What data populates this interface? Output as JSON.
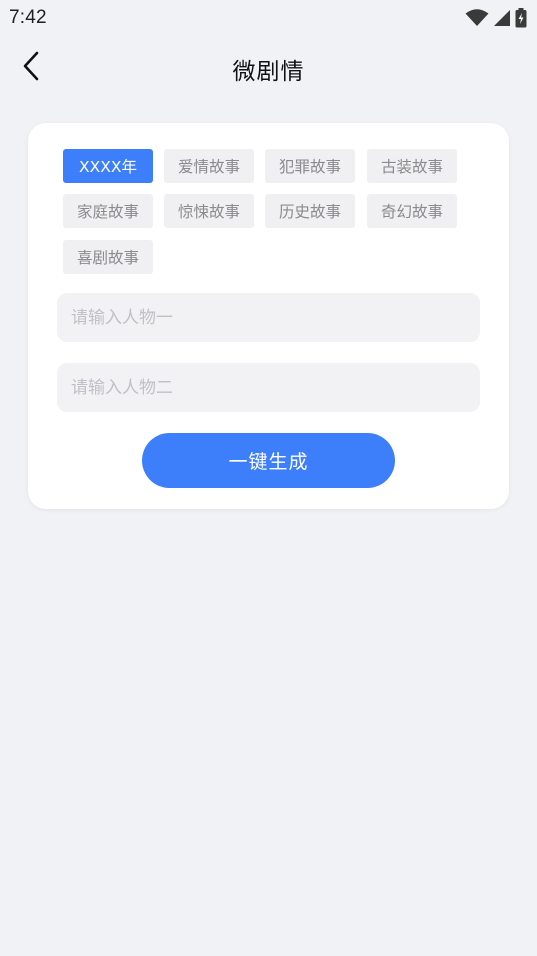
{
  "status_bar": {
    "time": "7:42",
    "icons": [
      "wifi-icon",
      "cellular-signal-icon",
      "battery-charging-icon"
    ]
  },
  "header": {
    "title": "微剧情",
    "back_icon": "chevron-left-icon"
  },
  "tags": [
    {
      "label": "XXXX年",
      "selected": true
    },
    {
      "label": "爱情故事",
      "selected": false
    },
    {
      "label": "犯罪故事",
      "selected": false
    },
    {
      "label": "古装故事",
      "selected": false
    },
    {
      "label": "家庭故事",
      "selected": false
    },
    {
      "label": "惊悚故事",
      "selected": false
    },
    {
      "label": "历史故事",
      "selected": false
    },
    {
      "label": "奇幻故事",
      "selected": false
    },
    {
      "label": "喜剧故事",
      "selected": false
    }
  ],
  "inputs": {
    "character_one": {
      "value": "",
      "placeholder": "请输入人物一"
    },
    "character_two": {
      "value": "",
      "placeholder": "请输入人物二"
    }
  },
  "generate_button": {
    "label": "一键生成"
  },
  "colors": {
    "accent": "#3d7ffa",
    "background": "#f1f2f5",
    "tag_background": "#f0f0f2",
    "tag_text": "#8b8b8f",
    "placeholder": "#c0c0c6"
  }
}
